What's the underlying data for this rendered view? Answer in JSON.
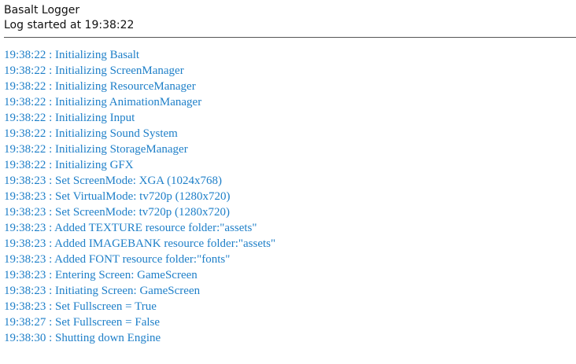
{
  "header": {
    "title": "Basalt Logger",
    "subtitle": "Log started at 19:38:22"
  },
  "colors": {
    "log_text": "#1e7fc8",
    "header_text": "#111111",
    "divider": "#555555",
    "background": "#ffffff"
  },
  "log": {
    "entries": [
      "19:38:22 : Initializing Basalt",
      "19:38:22 : Initializing ScreenManager",
      "19:38:22 : Initializing ResourceManager",
      "19:38:22 : Initializing AnimationManager",
      "19:38:22 : Initializing Input",
      "19:38:22 : Initializing Sound System",
      "19:38:22 : Initializing StorageManager",
      "19:38:22 : Initializing GFX",
      "19:38:23 : Set ScreenMode: XGA (1024x768)",
      "19:38:23 : Set VirtualMode: tv720p (1280x720)",
      "19:38:23 : Set ScreenMode: tv720p (1280x720)",
      "19:38:23 : Added TEXTURE resource folder:\"assets\"",
      "19:38:23 : Added IMAGEBANK resource folder:\"assets\"",
      "19:38:23 : Added FONT resource folder:\"fonts\"",
      "19:38:23 : Entering Screen: GameScreen",
      "19:38:23 : Initiating Screen: GameScreen",
      "19:38:23 : Set Fullscreen = True",
      "19:38:27 : Set Fullscreen = False",
      "19:38:30 : Shutting down Engine"
    ]
  }
}
